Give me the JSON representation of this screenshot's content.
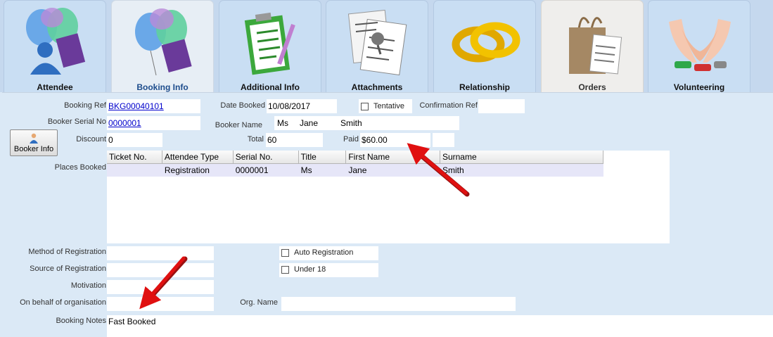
{
  "tabs": [
    {
      "id": "attendee",
      "label": "Attendee"
    },
    {
      "id": "booking-info",
      "label": "Booking Info"
    },
    {
      "id": "additional-info",
      "label": "Additional Info"
    },
    {
      "id": "attachments",
      "label": "Attachments"
    },
    {
      "id": "relationship",
      "label": "Relationship"
    },
    {
      "id": "orders",
      "label": "Orders"
    },
    {
      "id": "volunteering",
      "label": "Volunteering"
    }
  ],
  "active_tab": "Booking Info",
  "form": {
    "booking_ref": {
      "label": "Booking Ref",
      "value": "BKG00040101"
    },
    "date_booked": {
      "label": "Date Booked",
      "value": "10/08/2017"
    },
    "tentative": {
      "label": "Tentative",
      "checked": false
    },
    "confirmation_ref": {
      "label": "Confirmation Ref",
      "value": ""
    },
    "booker_serial_no": {
      "label": "Booker Serial No",
      "value": "0000001"
    },
    "booker_name": {
      "label": "Booker Name",
      "title": "Ms",
      "first": "Jane",
      "last": "Smith"
    },
    "discount": {
      "label": "Discount",
      "value": "0"
    },
    "total": {
      "label": "Total",
      "value": "60"
    },
    "paid": {
      "label": "Paid",
      "value": "$60.00"
    },
    "booker_info_button": "Booker Info",
    "places_booked": {
      "label": "Places Booked",
      "columns": [
        "Ticket No.",
        "Attendee Type",
        "Serial No.",
        "Title",
        "First Name",
        "Surname"
      ],
      "rows": [
        [
          "",
          "Registration",
          "0000001",
          "Ms",
          "Jane",
          "Smith"
        ]
      ]
    },
    "method_of_registration": {
      "label": "Method of Registration",
      "value": ""
    },
    "source_of_registration": {
      "label": "Source of Registration",
      "value": ""
    },
    "motivation": {
      "label": "Motivation",
      "value": ""
    },
    "on_behalf_of_organisation": {
      "label": "On behalf of organisation",
      "value": ""
    },
    "auto_registration": {
      "label": "Auto Registration",
      "checked": false
    },
    "under_18": {
      "label": "Under 18",
      "checked": false
    },
    "org_name": {
      "label": "Org. Name",
      "value": ""
    },
    "booking_notes": {
      "label": "Booking Notes",
      "value": "Fast Booked"
    }
  },
  "colors": {
    "annotation_arrow": "#e01010",
    "link": "#0000cc",
    "active_tab_label": "#1d4c8c"
  }
}
